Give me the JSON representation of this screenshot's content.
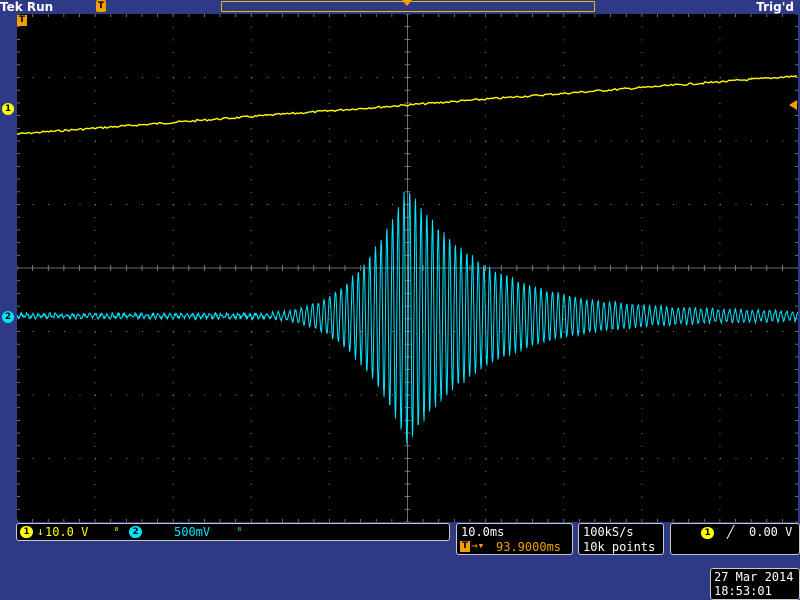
{
  "header": {
    "brand": "Tek Run",
    "trigger_state": "Trig'd"
  },
  "channels": {
    "ch1": {
      "label": "1",
      "color": "#ffff00",
      "scale": "10.0 V",
      "coupling_symbol": "⏚"
    },
    "ch2": {
      "label": "2",
      "color": "#00e5ff",
      "scale": "500mV"
    }
  },
  "timebase": {
    "scale": "10.0ms",
    "delay": "93.9000ms"
  },
  "acquisition": {
    "sample_rate": "100kS/s",
    "record_length": "10k points"
  },
  "trigger": {
    "source": "1",
    "slope_symbol": "╱",
    "level": "0.00 V",
    "marker": "T"
  },
  "datetime": {
    "date": "27 Mar 2014",
    "time": "18:53:01"
  },
  "colors": {
    "background": "#2f3a86",
    "screen": "#000000",
    "grid": "#8a8a8a",
    "trigger_orange": "#f0a000"
  }
}
